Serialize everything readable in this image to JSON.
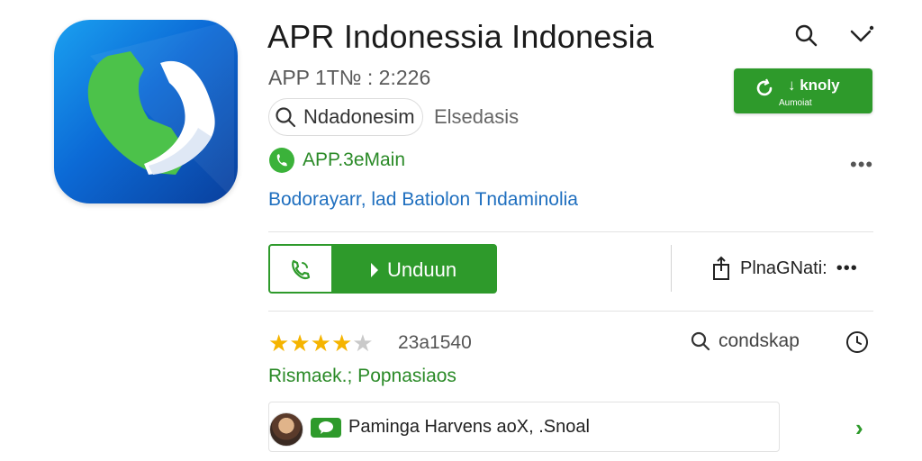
{
  "app": {
    "title": "APR Indonessia Indonesia",
    "subtitle": "APP 1T№ : 2:226",
    "icon_colors": {
      "top": "#1aa0f0",
      "bottom": "#0a3f9c",
      "handset": "#4cc24a"
    }
  },
  "header": {
    "search_icon": "search-icon",
    "more_icon": "chevron-more-icon"
  },
  "install_button": {
    "label": "↓ knoly",
    "sub_label": "Aumoiat"
  },
  "chips": {
    "primary": "Ndadonesim",
    "secondary": "Elsedasis"
  },
  "developer": {
    "name": "APP.3eMain"
  },
  "meta_link": "Bodorayarr, lad Batiolon Tndaminolia",
  "download_button": {
    "label": "Unduun"
  },
  "share": {
    "label": "PlnaGNati:"
  },
  "rating": {
    "stars": 4,
    "max": 5,
    "count": "23a1540"
  },
  "search_small": {
    "label": "condskap"
  },
  "category": "Rismaek.; Popnasiaos",
  "review": {
    "text": "Paminga Harvens aoX, .Snoal"
  },
  "colors": {
    "accent_green": "#2e9a2b",
    "link_blue": "#1f6fbf",
    "star_yellow": "#f5b400"
  }
}
